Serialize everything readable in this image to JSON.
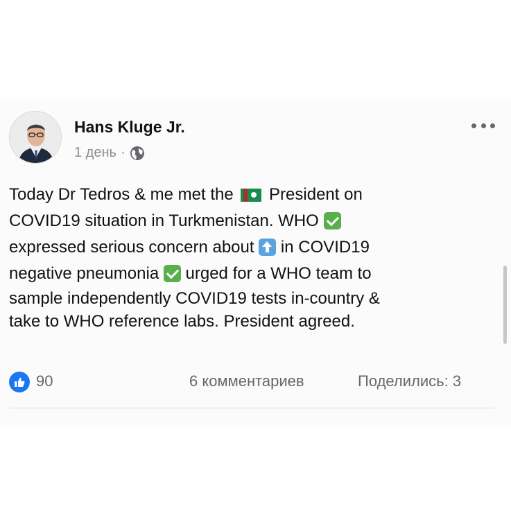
{
  "post": {
    "author": "Hans Kluge Jr.",
    "time": "1 день",
    "separator": "·",
    "privacy_icon": "globe-icon",
    "more_icon": "more-dots-icon",
    "body_lines": [
      [
        "Today Dr Tedros & me met the ",
        " President on"
      ],
      [
        "COVID19 situation in Turkmenistan. WHO "
      ],
      [
        "expressed serious concern about ",
        " in  COVID19"
      ],
      [
        "negative pneumonia ",
        " urged for a WHO team to"
      ],
      [
        "sample independently COVID19 tests in-country &"
      ],
      [
        "take to WHO reference labs. President agreed."
      ]
    ],
    "emojis": [
      "turkmenistan-flag-icon",
      "check-mark-icon",
      "up-arrow-icon",
      "check-mark-icon"
    ]
  },
  "stats": {
    "like_icon": "thumbs-up-icon",
    "likes": "90",
    "comments": "6 комментариев",
    "shares": "Поделились: 3"
  },
  "colors": {
    "accent": "#1877f2",
    "check_green": "#57b04a",
    "arrow_blue": "#5aa2e0",
    "secondary_text": "#65676b"
  }
}
